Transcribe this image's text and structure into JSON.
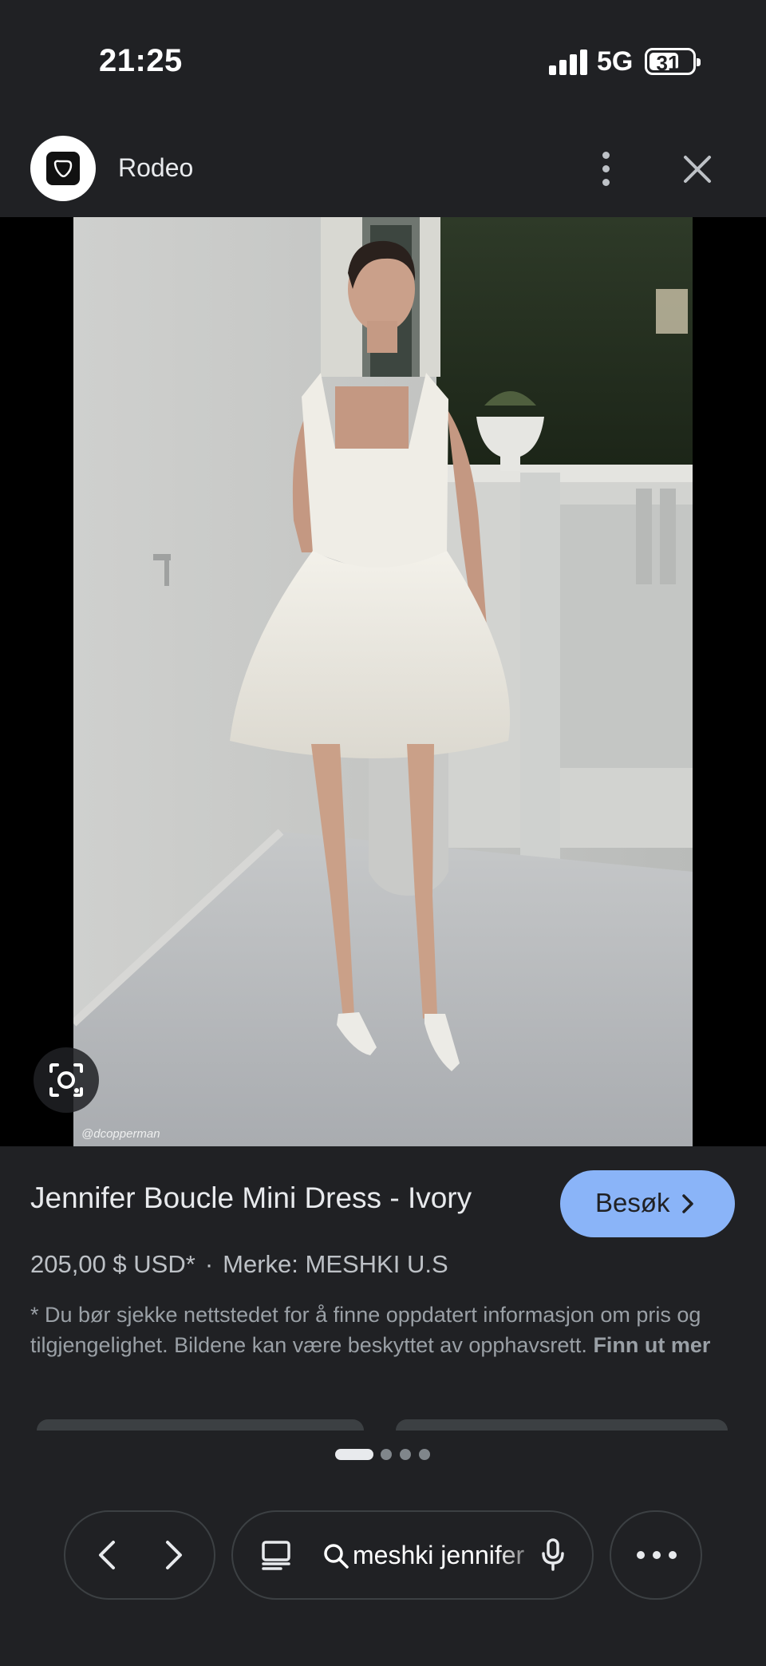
{
  "status_bar": {
    "time": "21:25",
    "network": "5G",
    "battery": "31"
  },
  "header": {
    "site_name": "Rodeo"
  },
  "image": {
    "watermark": "@dcopperman"
  },
  "product": {
    "title": "Jennifer Boucle Mini Dress - Ivory",
    "visit_label": "Besøk",
    "price": "205,00 $ USD*",
    "separator": "·",
    "brand": "Merke: MESHKI U.S",
    "disclaimer": "* Du bør sjekke nettstedet for å finne oppdatert informasjon om pris og tilgjengelighet. Bildene kan være beskyttet av opphavsrett.",
    "learn_more": "Finn ut mer"
  },
  "bottom_bar": {
    "search_query": "meshki jennifer"
  },
  "pagination": {
    "total": 4,
    "active": 1
  },
  "colors": {
    "background": "#202124",
    "accent": "#8ab4f8",
    "text_primary": "#e8eaed",
    "text_secondary": "#9aa0a6"
  }
}
